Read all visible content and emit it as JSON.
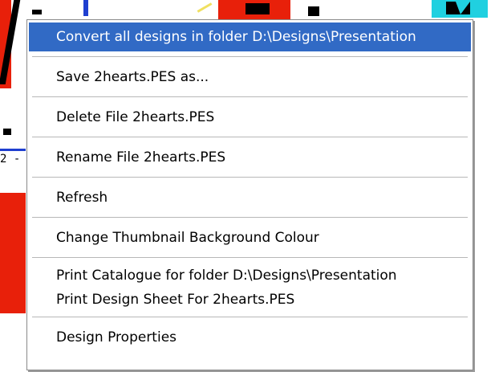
{
  "background": {
    "fragment_text": "2 -"
  },
  "context_menu": {
    "items": [
      {
        "label": "Convert all designs in folder D:\\Designs\\Presentation",
        "highlighted": true
      },
      {
        "label": "Save 2hearts.PES as..."
      },
      {
        "label": "Delete File 2hearts.PES"
      },
      {
        "label": "Rename File 2hearts.PES"
      },
      {
        "label": "Refresh"
      },
      {
        "label": "Change Thumbnail Background Colour"
      },
      {
        "label": "Print Catalogue for folder D:\\Designs\\Presentation"
      },
      {
        "label": "Print Design Sheet For 2hearts.PES"
      },
      {
        "label": "Design Properties"
      }
    ]
  },
  "colors": {
    "highlight": "#316ac5",
    "highlight_text": "#ffffff",
    "separator": "#b8b8b8",
    "menu_border": "#8a8a8a"
  }
}
